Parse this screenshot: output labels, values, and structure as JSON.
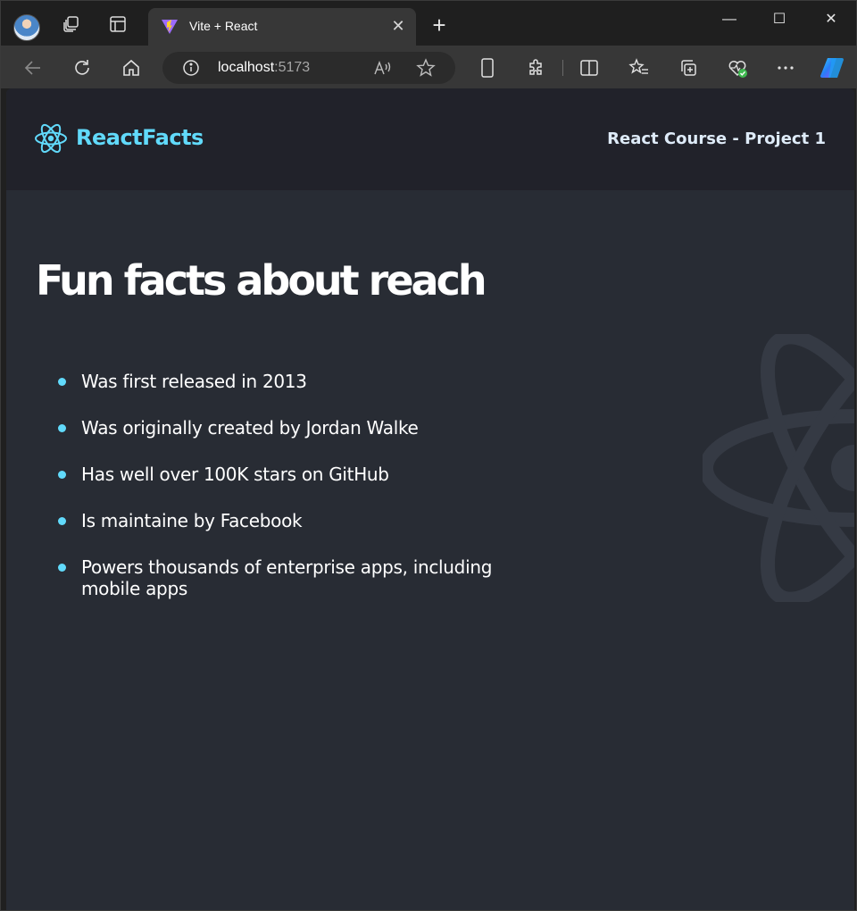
{
  "browser": {
    "tab": {
      "title": "Vite + React",
      "close_glyph": "✕"
    },
    "new_tab_glyph": "+",
    "window_controls": {
      "minimize": "—",
      "maximize": "☐",
      "close": "✕"
    },
    "address": {
      "host": "localhost",
      "port": ":5173"
    },
    "colors": {
      "titlebar": "#1f1f1f",
      "toolbar": "#373737",
      "urlbar": "#2b2b2b"
    }
  },
  "page": {
    "navbar": {
      "brand": "ReactFacts",
      "right_text": "React Course - Project 1"
    },
    "heading": "Fun facts about reach",
    "facts": [
      "Was first released in 2013",
      "Was originally created by Jordan Walke",
      "Has well over 100K stars on GitHub",
      "Is maintaine by Facebook",
      "Powers thousands of enterprise apps, including mobile apps"
    ],
    "colors": {
      "accent": "#61dafb",
      "background": "#282c34",
      "navbar": "#21222a",
      "text": "#ffffff"
    }
  },
  "icons": [
    "profile-avatar",
    "workspaces-icon",
    "tab-actions-icon",
    "vite-favicon",
    "back-icon",
    "refresh-icon",
    "home-icon",
    "info-icon",
    "read-aloud-icon",
    "favorite-star-icon",
    "device-icon",
    "extensions-icon",
    "split-screen-icon",
    "favorites-icon",
    "collections-icon",
    "browser-essentials-icon",
    "more-icon",
    "copilot-icon",
    "react-logo-icon"
  ]
}
